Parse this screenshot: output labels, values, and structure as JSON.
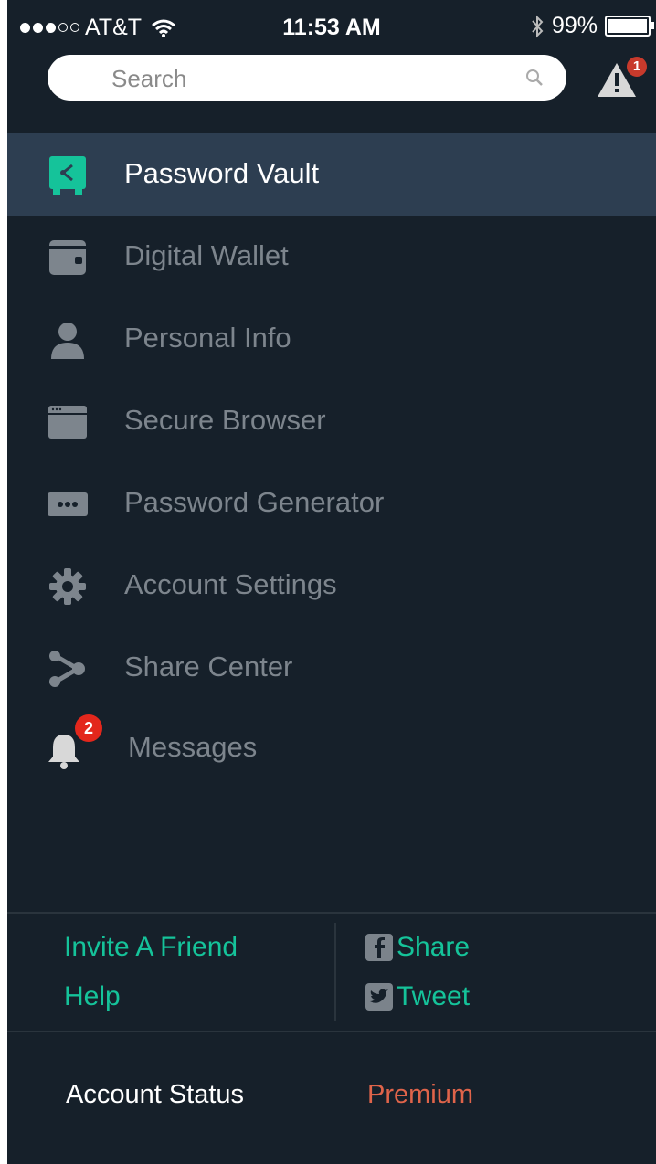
{
  "status_bar": {
    "carrier": "AT&T",
    "time": "11:53 AM",
    "battery": "99%"
  },
  "search": {
    "placeholder": "Search"
  },
  "alert": {
    "badge": "1"
  },
  "menu": {
    "items": [
      {
        "label": "Password Vault",
        "icon": "vault-icon",
        "active": true
      },
      {
        "label": "Digital Wallet",
        "icon": "wallet-icon"
      },
      {
        "label": "Personal Info",
        "icon": "person-icon"
      },
      {
        "label": "Secure Browser",
        "icon": "browser-icon"
      },
      {
        "label": "Password Generator",
        "icon": "password-dots-icon"
      },
      {
        "label": "Account Settings",
        "icon": "gear-icon"
      },
      {
        "label": "Share Center",
        "icon": "share-icon"
      },
      {
        "label": "Messages",
        "icon": "bell-icon",
        "badge": "2"
      }
    ]
  },
  "footer": {
    "invite": "Invite A Friend",
    "help": "Help",
    "share": "Share",
    "tweet": "Tweet",
    "account_status_label": "Account Status",
    "account_status_value": "Premium"
  },
  "colors": {
    "background": "#16202a",
    "active_item": "#2d3e51",
    "accent_green": "#15c39a",
    "premium": "#e0644a",
    "badge_red": "#e3271c"
  }
}
